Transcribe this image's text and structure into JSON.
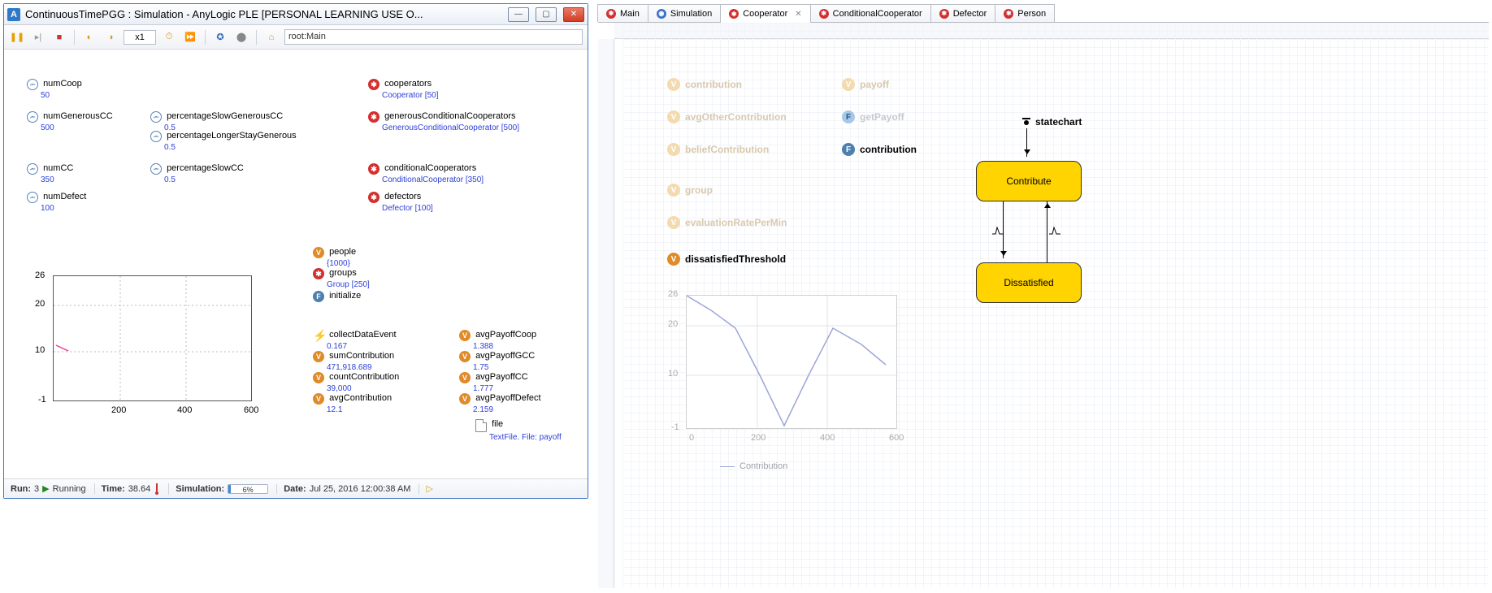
{
  "sim_window": {
    "title": "ContinuousTimePGG : Simulation - AnyLogic PLE [PERSONAL LEARNING USE O...",
    "speed": "x1",
    "root_label": "root:Main",
    "params": {
      "numCoop": {
        "label": "numCoop",
        "value": "50"
      },
      "numGenerousCC": {
        "label": "numGenerousCC",
        "value": "500"
      },
      "percentageSlowGenerousCC": {
        "label": "percentageSlowGenerousCC",
        "value": "0.5"
      },
      "percentageLongerStayGenerous": {
        "label": "percentageLongerStayGenerous",
        "value": "0.5"
      },
      "numCC": {
        "label": "numCC",
        "value": "350"
      },
      "percentageSlowCC": {
        "label": "percentageSlowCC",
        "value": "0.5"
      },
      "numDefect": {
        "label": "numDefect",
        "value": "100"
      }
    },
    "agents": {
      "cooperators": {
        "label": "cooperators",
        "value": "Cooperator [50]"
      },
      "generousConditionalCooperators": {
        "label": "generousConditionalCooperators",
        "value": "GenerousConditionalCooperator [500]"
      },
      "conditionalCooperators": {
        "label": "conditionalCooperators",
        "value": "ConditionalCooperator [350]"
      },
      "defectors": {
        "label": "defectors",
        "value": "Defector [100]"
      }
    },
    "vars": {
      "people": {
        "label": "people",
        "value": "{1000}"
      },
      "groups": {
        "label": "groups",
        "value": "Group [250]"
      },
      "initialize": {
        "label": "initialize"
      },
      "collectDataEvent": {
        "label": "collectDataEvent",
        "value": "0.167"
      },
      "sumContribution": {
        "label": "sumContribution",
        "value": "471,918.689"
      },
      "countContribution": {
        "label": "countContribution",
        "value": "39,000"
      },
      "avgContribution": {
        "label": "avgContribution",
        "value": "12.1"
      },
      "avgPayoffCoop": {
        "label": "avgPayoffCoop",
        "value": "1.388"
      },
      "avgPayoffGCC": {
        "label": "avgPayoffGCC",
        "value": "1.75"
      },
      "avgPayoffCC": {
        "label": "avgPayoffCC",
        "value": "1.777"
      },
      "avgPayoffDefect": {
        "label": "avgPayoffDefect",
        "value": "2.159"
      },
      "file": {
        "label": "file",
        "value": "TextFile. File: payoff"
      }
    },
    "statusbar": {
      "run_label": "Run:",
      "run_num": "3",
      "status": "Running",
      "time_label": "Time:",
      "time_value": "38.64",
      "sim_label": "Simulation:",
      "progress_pct": "6%",
      "date_label": "Date:",
      "date_value": "Jul 25, 2016 12:00:38 AM"
    },
    "chart_axes": {
      "ymax": "26",
      "y20": "20",
      "y10": "10",
      "ymin": "-1",
      "x200": "200",
      "x400": "400",
      "x600": "600"
    }
  },
  "editor": {
    "tabs": [
      {
        "label": "Main",
        "color": "red"
      },
      {
        "label": "Simulation",
        "color": "blue"
      },
      {
        "label": "Cooperator",
        "color": "red",
        "active": true
      },
      {
        "label": "ConditionalCooperator",
        "color": "red"
      },
      {
        "label": "Defector",
        "color": "red"
      },
      {
        "label": "Person",
        "color": "red"
      }
    ],
    "ghost_items": {
      "contribution": "contribution",
      "payoff": "payoff",
      "avgOtherContribution": "avgOtherContribution",
      "getPayoff": "getPayoff",
      "beliefContribution": "beliefContribution",
      "group": "group",
      "evaluationRatePerMin": "evaluationRatePerMin"
    },
    "solid_items": {
      "contribution_fn": "contribution",
      "dissatisfiedThreshold": "dissatisfiedThreshold"
    },
    "statechart": {
      "label": "statechart",
      "state1": "Contribute",
      "state2": "Dissatisfied"
    },
    "chart": {
      "legend": "Contribution",
      "yticks": [
        "26",
        "20",
        "10",
        "-1"
      ],
      "xticks": [
        "0",
        "200",
        "400",
        "600"
      ]
    }
  },
  "chart_data": {
    "type": "line",
    "title": "",
    "xlabel": "",
    "ylabel": "",
    "xlim": [
      0,
      600
    ],
    "ylim": [
      -1,
      26
    ],
    "series": [
      {
        "name": "Contribution",
        "x": [
          0,
          70,
          140,
          210,
          280,
          350,
          420,
          490,
          560
        ],
        "values": [
          26,
          23,
          19,
          10,
          -1,
          10,
          20,
          16,
          13
        ]
      }
    ]
  }
}
